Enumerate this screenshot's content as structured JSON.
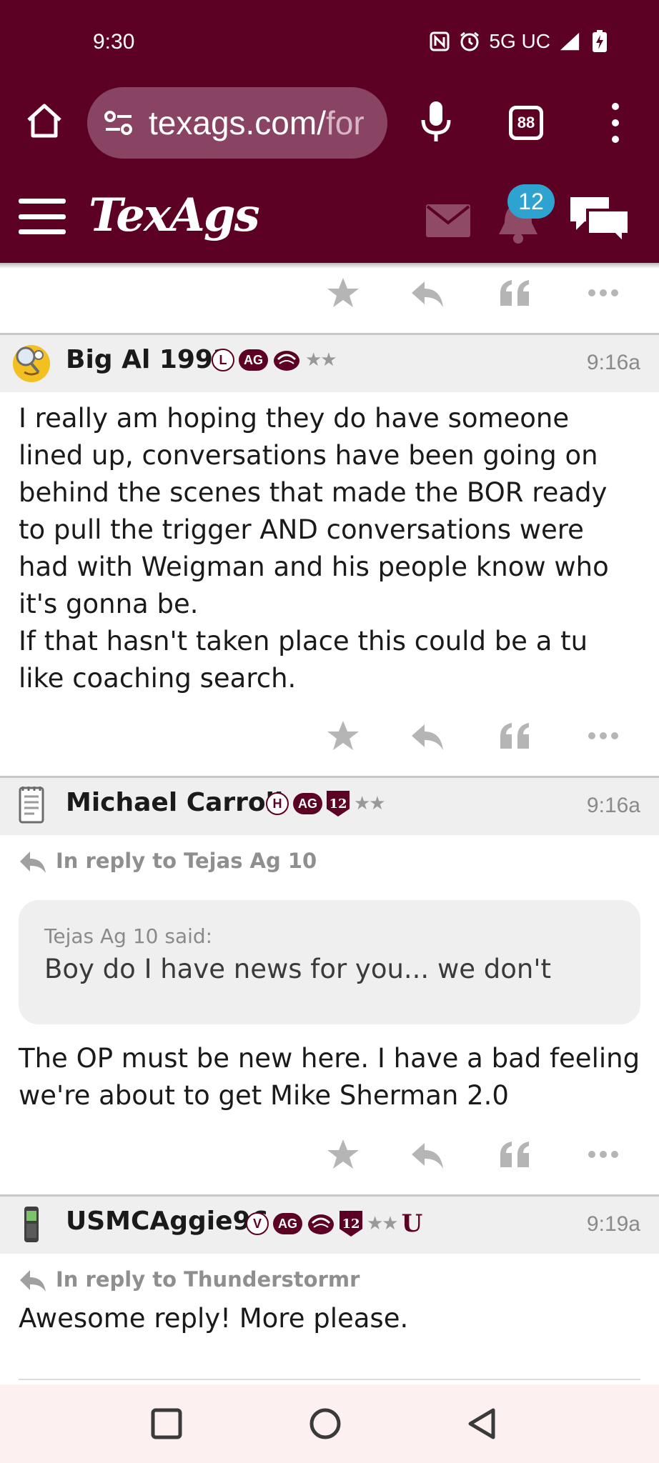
{
  "status_bar": {
    "time": "9:30",
    "network": "5G UC"
  },
  "browser": {
    "url_host": "texags.com/",
    "url_rest": "for",
    "tab_count": "88"
  },
  "site": {
    "logo_text": "TexAgs",
    "notification_count": "12"
  },
  "posts": [
    {
      "username": "Big Al 1992",
      "badge_letter": "L",
      "badge_ag": "AG",
      "stars": "★★",
      "time": "9:16a",
      "body": "I really am hoping they do have someone lined up, conversations have been going on behind the scenes that made the BOR ready to pull the trigger AND conversations were had with Weigman and his people know who it's gonna be.\nIf that hasn't taken place this could be a tu like coaching search."
    },
    {
      "username": "Michael Carroll",
      "badge_letter": "H",
      "badge_ag": "AG",
      "badge_12": "12",
      "stars": "★★",
      "time": "9:16a",
      "in_reply_to": "In reply to Tejas Ag 10",
      "quote_said": "Tejas Ag 10 said:",
      "quote_text": "Boy do I have news for you... we don't",
      "body": "The OP must be new here. I have a bad feeling we're about to get Mike Sherman 2.0"
    },
    {
      "username": "USMCAggie96",
      "badge_letter": "V",
      "badge_ag": "AG",
      "badge_12": "12",
      "stars": "★★",
      "badge_u": "U",
      "time": "9:19a",
      "in_reply_to": "In reply to Thunderstormr",
      "body": "Awesome reply! More please."
    }
  ],
  "colors": {
    "maroon": "#5c0024",
    "badge_blue": "#2fa3cf",
    "meta_gray": "#8a8a8a"
  }
}
